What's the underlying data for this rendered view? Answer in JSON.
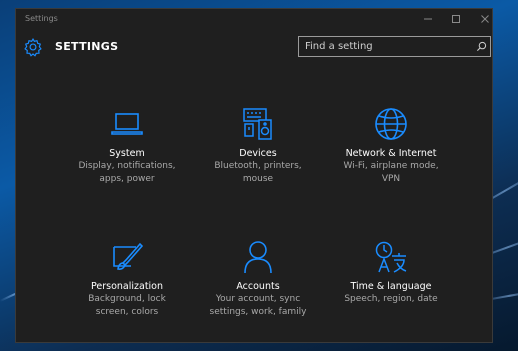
{
  "window": {
    "title": "Settings",
    "controls": {
      "minimize_icon": "minimize-icon",
      "maximize_icon": "maximize-icon",
      "close_icon": "close-icon"
    }
  },
  "header": {
    "title": "SETTINGS",
    "icon": "gear-icon"
  },
  "search": {
    "placeholder": "Find a setting",
    "value": "",
    "icon": "search-icon"
  },
  "colors": {
    "accent": "#1a8cff",
    "background": "#1f1f1f",
    "text": "#ffffff",
    "subtext": "#a9a9a9"
  },
  "categories": [
    {
      "icon": "laptop-icon",
      "label": "System",
      "desc": "Display, notifications,\napps, power"
    },
    {
      "icon": "devices-icon",
      "label": "Devices",
      "desc": "Bluetooth, printers,\nmouse"
    },
    {
      "icon": "globe-icon",
      "label": "Network & Internet",
      "desc": "Wi-Fi, airplane mode,\nVPN"
    },
    {
      "icon": "personalization-icon",
      "label": "Personalization",
      "desc": "Background, lock\nscreen, colors"
    },
    {
      "icon": "person-icon",
      "label": "Accounts",
      "desc": "Your account, sync\nsettings, work, family"
    },
    {
      "icon": "time-language-icon",
      "label": "Time & language",
      "desc": "Speech, region, date"
    }
  ]
}
